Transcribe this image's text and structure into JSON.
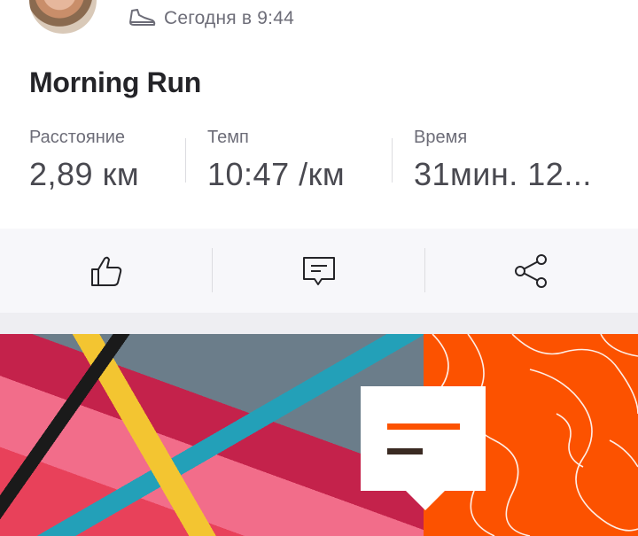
{
  "header": {
    "timestamp": "Сегодня в 9:44",
    "activity_icon": "shoe-icon"
  },
  "activity": {
    "title": "Morning Run",
    "stats": [
      {
        "label": "Расстояние",
        "value": "2,89 км"
      },
      {
        "label": "Темп",
        "value": "10:47 /км"
      },
      {
        "label": "Время",
        "value": "31мин. 12..."
      }
    ]
  },
  "actions": {
    "like_icon": "thumbs-up-icon",
    "comment_icon": "comment-icon",
    "share_icon": "share-icon"
  },
  "colors": {
    "brand_orange": "#fc5200",
    "text_dark": "#242428",
    "text_muted": "#6d6d78",
    "actions_bg": "#f7f7fa"
  }
}
